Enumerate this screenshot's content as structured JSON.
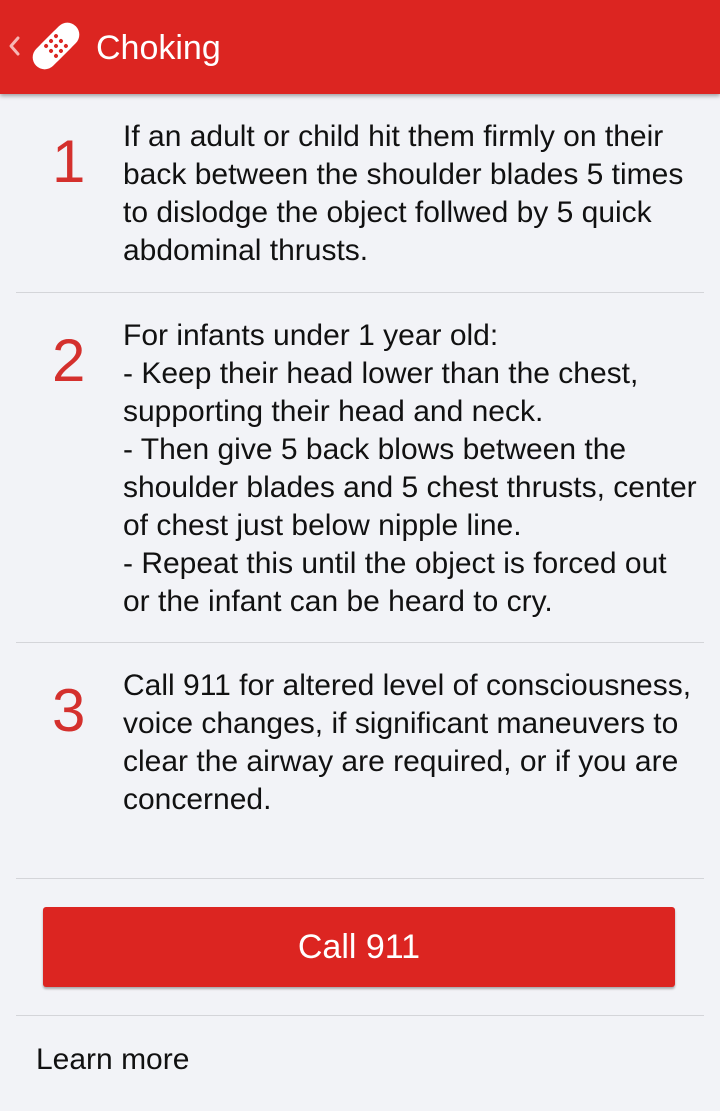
{
  "header": {
    "title": "Choking",
    "back_icon": "chevron-left-icon",
    "app_icon": "bandage-icon",
    "bar_color": "#dc2521"
  },
  "steps": [
    {
      "number": "1",
      "text": "If an adult or child hit them firmly on their back between the shoulder blades 5 times to dislodge the object follwed by 5 quick abdominal thrusts."
    },
    {
      "number": "2",
      "text": "For infants under 1 year old:\n- Keep their head lower than the chest, supporting their head and neck.\n- Then give 5 back blows between the shoulder blades and 5 chest thrusts, center of chest just below nipple line.\n- Repeat this until the object is forced out or the infant can be heard to cry."
    },
    {
      "number": "3",
      "text": "Call 911 for altered level of consciousness, voice changes, if significant maneuvers to clear the airway are required, or if you are concerned."
    }
  ],
  "call_button": {
    "label": "Call 911",
    "color": "#dc2521"
  },
  "learn_more": {
    "label": "Learn more"
  },
  "colors": {
    "accent": "#dc2521",
    "step_number": "#d4302d",
    "background": "#f2f3f7"
  }
}
